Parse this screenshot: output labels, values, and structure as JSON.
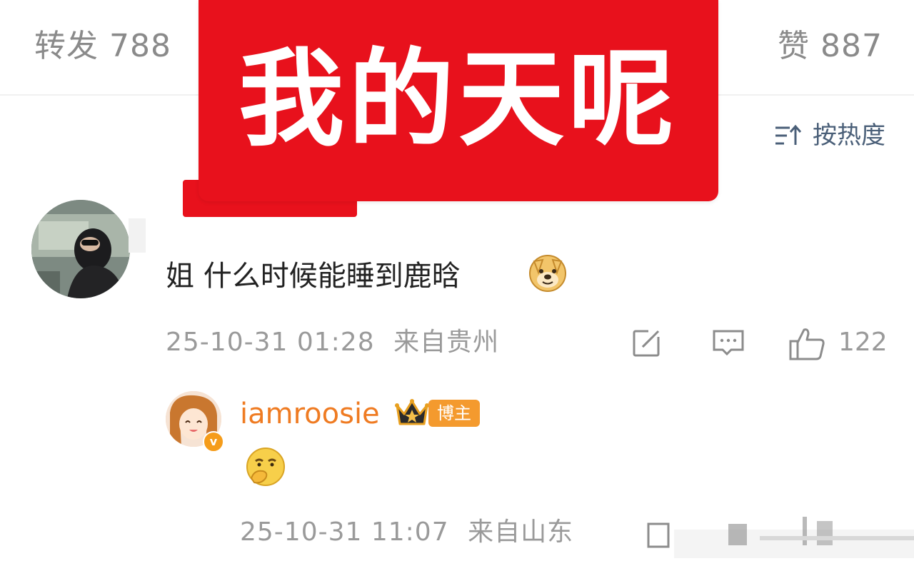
{
  "header": {
    "repost_label": "转发 788",
    "like_label": "赞 887"
  },
  "banner": {
    "text": "我的天呢"
  },
  "sort": {
    "label": "按热度",
    "icon": "sort-icon"
  },
  "comment": {
    "text": "姐 什么时候能睡到鹿晗",
    "emoji": "doge-emoji",
    "time": "25-10-31 01:28",
    "location": "来自贵州",
    "likes": "122",
    "actions": [
      "repost-icon",
      "reply-icon",
      "like-icon"
    ]
  },
  "reply": {
    "username": "iamroosie",
    "badge": "博主",
    "verified_mark": "v",
    "emoji": "thinking-emoji",
    "time": "25-10-31 11:07",
    "location": "来自山东"
  },
  "colors": {
    "banner_red": "#e8111c",
    "username_orange": "#ef7b22",
    "badge_orange": "#f49a2e",
    "sort_blue_gray": "#4a5f78",
    "meta_gray": "#9a9a9a"
  }
}
